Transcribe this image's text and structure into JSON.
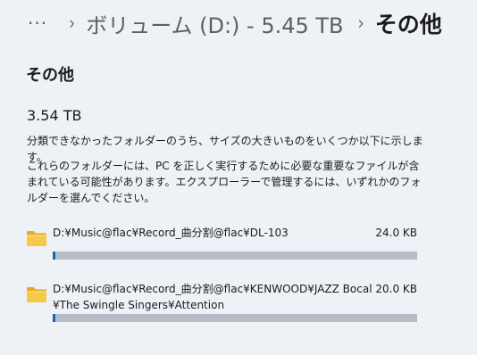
{
  "breadcrumb": {
    "more": "···",
    "separator": "›",
    "volume": "ボリューム (D:) - 5.45 TB",
    "current": "その他"
  },
  "section_title": "その他",
  "total_size": "3.54 TB",
  "description_1": "分類できなかったフォルダーのうち、サイズの大きいものをいくつか以下に示します。",
  "description_2": "これらのフォルダーには、PC を正しく実行するために必要な重要なファイルが含まれている可能性があります。エクスプローラーで管理するには、いずれかのフォルダーを選んでください。",
  "folders": [
    {
      "path": "D:¥Music@flac¥Record_曲分割@flac¥DL-103",
      "size": "24.0 KB",
      "usage_percent": 0.7,
      "icon": "folder-icon"
    },
    {
      "path": "D:¥Music@flac¥Record_曲分割@flac¥KENWOOD¥JAZZ Bocal¥The Swingle Singers¥Attention",
      "size": "20.0 KB",
      "usage_percent": 0.7,
      "icon": "folder-icon"
    }
  ],
  "colors": {
    "background": "#eef1f6",
    "bar_track": "#b7bdc4",
    "bar_fill": "#1268c3",
    "folder_yellow": "#f7c948"
  }
}
